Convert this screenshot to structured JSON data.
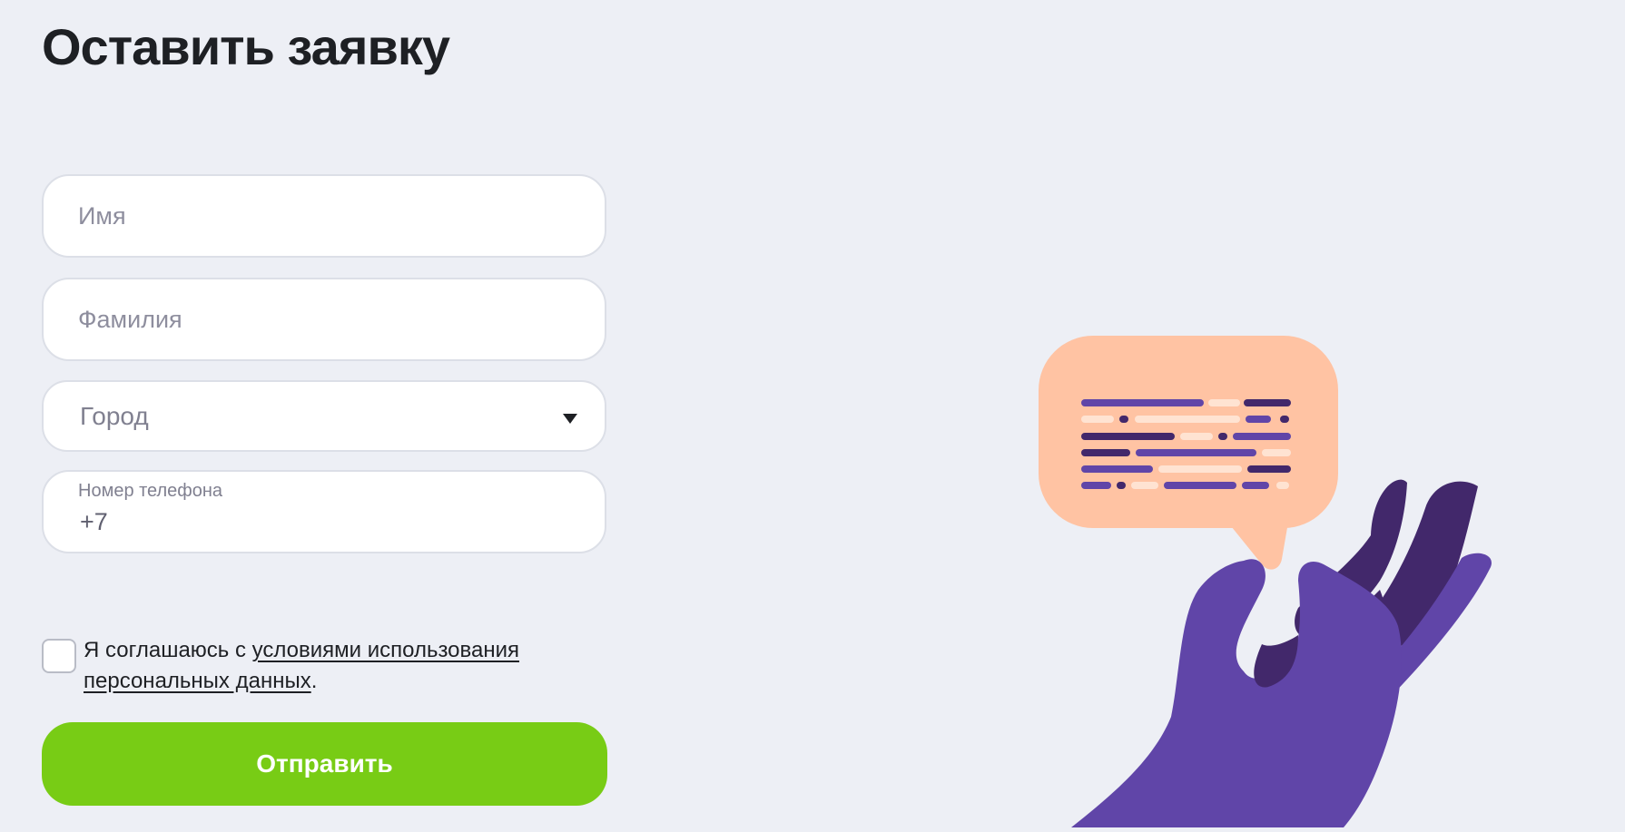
{
  "page": {
    "title": "Оставить заявку"
  },
  "form": {
    "name_placeholder": "Имя",
    "surname_placeholder": "Фамилия",
    "city_selected": "Город",
    "phone_label": "Номер телефона",
    "phone_value": "+7",
    "consent_text_prefix": "Я соглашаюсь с ",
    "consent_link": "условиями использования персональных данных",
    "consent_text_suffix": ".",
    "submit_label": "Отправить"
  },
  "colors": {
    "background": "#edeff5",
    "accent_green": "#78cc15",
    "bubble_peach": "#ffc3a3",
    "hand_purple": "#6045a8",
    "hand_dark_purple": "#42286b"
  },
  "icons": {
    "city_select": "chevron-down-icon",
    "illustration": "hand-holding-chat-bubble"
  }
}
